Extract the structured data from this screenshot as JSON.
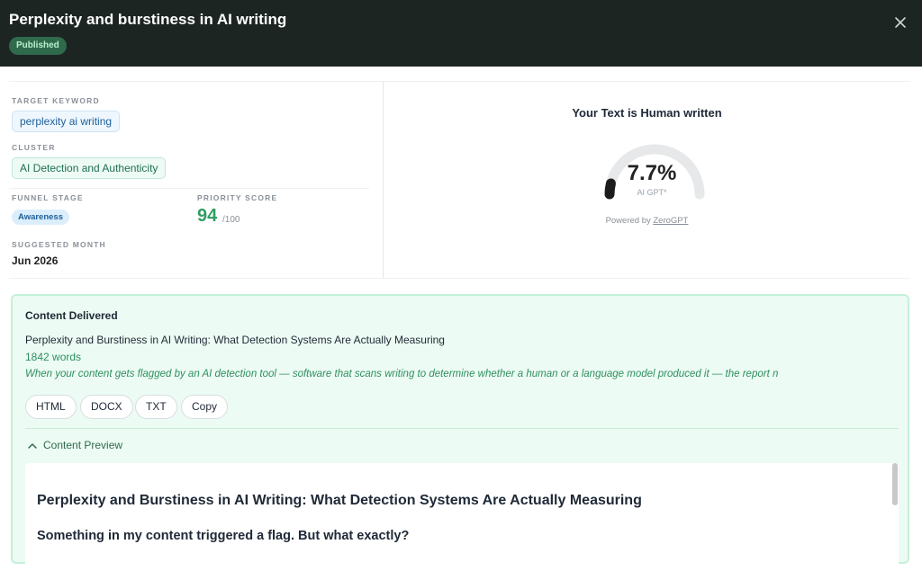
{
  "header": {
    "title": "Perplexity and burstiness in AI writing",
    "status_badge": "Published",
    "close_icon": "close-icon"
  },
  "meta": {
    "target_keyword_label": "TARGET KEYWORD",
    "target_keyword": "perplexity ai writing",
    "cluster_label": "CLUSTER",
    "cluster": "AI Detection and Authenticity",
    "funnel_stage_label": "FUNNEL STAGE",
    "funnel_stage": "Awareness",
    "priority_score_label": "PRIORITY SCORE",
    "priority_score": "94",
    "priority_score_max": "/100",
    "suggested_month_label": "SUGGESTED MONTH",
    "suggested_month": "Jun 2026"
  },
  "detection": {
    "title": "Your Text is Human written",
    "percent": "7.7%",
    "percent_value": 7.7,
    "sub_label": "AI GPT*",
    "powered_by_prefix": "Powered by",
    "powered_by_link": "ZeroGPT"
  },
  "delivered": {
    "section_title": "Content Delivered",
    "headline": "Perplexity and Burstiness in AI Writing: What Detection Systems Are Actually Measuring",
    "word_count": "1842 words",
    "excerpt": "When your content gets flagged by an AI detection tool — software that scans writing to determine whether a human or a language model produced it — the report n",
    "buttons": [
      "HTML",
      "DOCX",
      "TXT",
      "Copy"
    ],
    "preview_toggle_label": "Content Preview"
  },
  "preview": {
    "h1": "Perplexity and Burstiness in AI Writing: What Detection Systems Are Actually Measuring",
    "h2": "Something in my content triggered a flag. But what exactly?"
  },
  "colors": {
    "topbar_bg": "#1d2523",
    "accent_green": "#2f9e62",
    "delivered_bg": "#ecfbf3"
  }
}
